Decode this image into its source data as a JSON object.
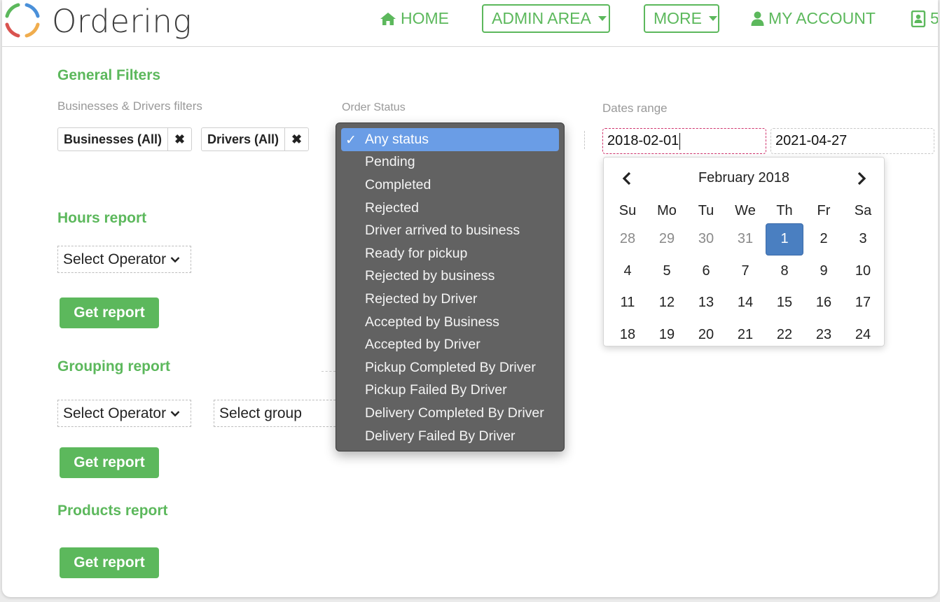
{
  "app": {
    "name": "Ordering",
    "logo_colors": [
      "#5cb85c",
      "#4a90d9",
      "#f0ad4e",
      "#d9534f"
    ]
  },
  "nav": {
    "home": "HOME",
    "admin_area": "ADMIN AREA",
    "more": "MORE",
    "my_account": "MY ACCOUNT",
    "contact_partial": "5"
  },
  "filters": {
    "section_title": "General Filters",
    "businesses_drivers_label": "Businesses & Drivers filters",
    "businesses_chip": "Businesses (All)",
    "drivers_chip": "Drivers (All)",
    "remove_glyph": "✖",
    "order_status_label": "Order Status",
    "dates_range_label": "Dates range",
    "date_from": "2018-02-01",
    "date_to": "2021-04-27"
  },
  "order_status": {
    "selected_index": 0,
    "check_glyph": "✓",
    "options": [
      "Any status",
      "Pending",
      "Completed",
      "Rejected",
      "Driver arrived to business",
      "Ready for pickup",
      "Rejected by business",
      "Rejected by Driver",
      "Accepted by Business",
      "Accepted by Driver",
      "Pickup Completed By Driver",
      "Pickup Failed By Driver",
      "Delivery Completed By Driver",
      "Delivery Failed By Driver"
    ]
  },
  "calendar": {
    "month_label": "February 2018",
    "weekdays": [
      "Su",
      "Mo",
      "Tu",
      "We",
      "Th",
      "Fr",
      "Sa"
    ],
    "weeks": [
      [
        {
          "d": "28",
          "muted": true
        },
        {
          "d": "29",
          "muted": true
        },
        {
          "d": "30",
          "muted": true
        },
        {
          "d": "31",
          "muted": true
        },
        {
          "d": "1",
          "selected": true
        },
        {
          "d": "2"
        },
        {
          "d": "3"
        }
      ],
      [
        {
          "d": "4"
        },
        {
          "d": "5"
        },
        {
          "d": "6"
        },
        {
          "d": "7"
        },
        {
          "d": "8"
        },
        {
          "d": "9"
        },
        {
          "d": "10"
        }
      ],
      [
        {
          "d": "11"
        },
        {
          "d": "12"
        },
        {
          "d": "13"
        },
        {
          "d": "14"
        },
        {
          "d": "15"
        },
        {
          "d": "16"
        },
        {
          "d": "17"
        }
      ],
      [
        {
          "d": "18"
        },
        {
          "d": "19"
        },
        {
          "d": "20"
        },
        {
          "d": "21"
        },
        {
          "d": "22"
        },
        {
          "d": "23"
        },
        {
          "d": "24"
        }
      ]
    ]
  },
  "hours_report": {
    "title": "Hours report",
    "operator_placeholder": "Select Operator",
    "button": "Get report"
  },
  "grouping_report": {
    "title": "Grouping report",
    "operator_placeholder": "Select Operator",
    "group_placeholder": "Select group",
    "button": "Get report"
  },
  "products_report": {
    "title": "Products report",
    "button": "Get report"
  }
}
